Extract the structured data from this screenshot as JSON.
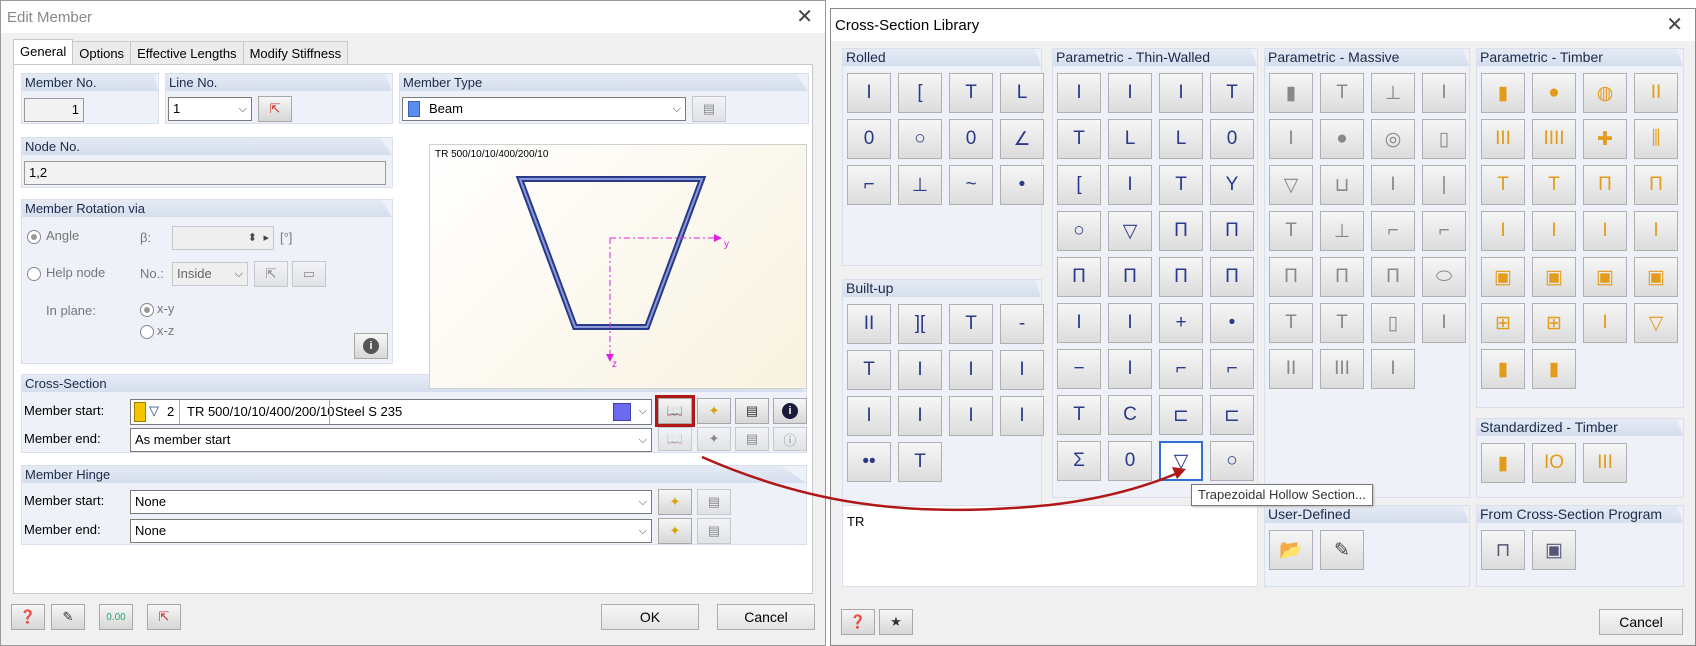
{
  "edit_member": {
    "title": "Edit Member",
    "tabs": [
      "General",
      "Options",
      "Effective Lengths",
      "Modify Stiffness"
    ],
    "member_no": {
      "label": "Member No.",
      "value": "1"
    },
    "line_no": {
      "label": "Line No.",
      "value": "1"
    },
    "member_type": {
      "label": "Member Type",
      "value": "Beam",
      "color": "#5b8def"
    },
    "node_no": {
      "label": "Node No.",
      "value": "1,2"
    },
    "rotation": {
      "label": "Member Rotation via",
      "angle": "Angle",
      "beta": "β:",
      "unit": "[°]",
      "help_node": "Help node",
      "no": "No.:",
      "inside": "Inside",
      "in_plane": "In plane:",
      "xy": "x-y",
      "xz": "x-z"
    },
    "preview": {
      "caption": "TR 500/10/10/400/200/10",
      "y": "y",
      "z": "z"
    },
    "cross_section": {
      "label": "Cross-Section",
      "start_label": "Member start:",
      "end_label": "Member end:",
      "num": "2",
      "name": "TR 500/10/10/400/200/10",
      "material": "Steel S 235",
      "end_value": "As member start",
      "material_color": "#6b6bf0",
      "section_color": "#f5c400"
    },
    "hinge": {
      "label": "Member Hinge",
      "start_label": "Member start:",
      "end_label": "Member end:",
      "start_value": "None",
      "end_value": "None"
    },
    "buttons": {
      "ok": "OK",
      "cancel": "Cancel"
    }
  },
  "library": {
    "title": "Cross-Section Library",
    "groups": {
      "rolled": "Rolled",
      "builtup": "Built-up",
      "thin": "Parametric - Thin-Walled",
      "massive": "Parametric - Massive",
      "timber": "Parametric - Timber",
      "std_timber": "Standardized - Timber",
      "user": "User-Defined",
      "program": "From Cross-Section Program"
    },
    "filter_text": "TR",
    "tooltip": "Trapezoidal Hollow Section...",
    "cancel": "Cancel",
    "rolled_icons": [
      "Ι",
      "[",
      "T",
      "L",
      "0",
      "○",
      "0",
      "∠",
      "⌐",
      "⊥",
      "~",
      "•"
    ],
    "builtup_icons": [
      "II",
      "][",
      "T",
      "-",
      "T",
      "I",
      "I",
      "I",
      "I",
      "I",
      "I",
      "I",
      "••",
      "T"
    ],
    "thin_icons": [
      "Ι",
      "Ι",
      "Ι",
      "T",
      "T",
      "L",
      "L",
      "0",
      "[",
      "I",
      "T",
      "Y",
      "○",
      "▽",
      "Π",
      "Π",
      "Π",
      "Π",
      "Π",
      "Π",
      "I",
      "I",
      "+",
      "•",
      "−",
      "I",
      "⌐",
      "⌐",
      "T",
      "C",
      "⊏",
      "⊏",
      "Σ",
      "0",
      "▽",
      "○"
    ],
    "massive_icons": [
      "▮",
      "T",
      "⊥",
      "I",
      "I",
      "●",
      "◎",
      "▯",
      "▽",
      "⊔",
      "I",
      "|",
      "T",
      "⊥",
      "⌐",
      "⌐",
      "Π",
      "Π",
      "Π",
      "⬭",
      "T",
      "T",
      "▯",
      "I",
      "II",
      "III",
      "I"
    ],
    "timber_icons": [
      "▮",
      "●",
      "◍",
      "II",
      "III",
      "IIII",
      "✚",
      "⫼",
      "T",
      "T",
      "Π",
      "Π",
      "I",
      "I",
      "I",
      "I",
      "▣",
      "▣",
      "▣",
      "▣",
      "⊞",
      "⊞",
      "I",
      "▽",
      "▮",
      "▮"
    ],
    "std_timber_icons": [
      "▮",
      "IO",
      "III"
    ]
  }
}
